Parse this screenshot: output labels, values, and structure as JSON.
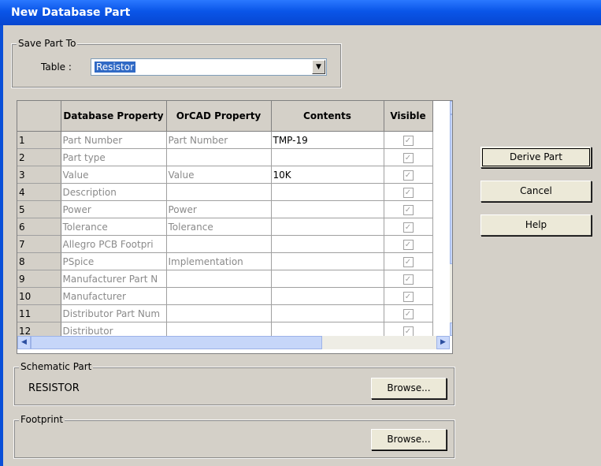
{
  "window": {
    "title": "New Database Part"
  },
  "save_part": {
    "legend": "Save Part To",
    "table_label": "Table :",
    "table_value": "Resistor"
  },
  "grid": {
    "columns": [
      "Database Property",
      "OrCAD Property",
      "Contents",
      "Visible"
    ],
    "rows": [
      {
        "num": "1",
        "db": "Part Number",
        "orcad": "Part Number",
        "contents": "TMP-19",
        "visible": true
      },
      {
        "num": "2",
        "db": "Part type",
        "orcad": "",
        "contents": "",
        "visible": true
      },
      {
        "num": "3",
        "db": "Value",
        "orcad": "Value",
        "contents": "10K",
        "visible": true
      },
      {
        "num": "4",
        "db": "Description",
        "orcad": "",
        "contents": "",
        "visible": true
      },
      {
        "num": "5",
        "db": "Power",
        "orcad": "Power",
        "contents": "",
        "visible": true
      },
      {
        "num": "6",
        "db": "Tolerance",
        "orcad": "Tolerance",
        "contents": "",
        "visible": true
      },
      {
        "num": "7",
        "db": "Allegro PCB Footpri",
        "orcad": "",
        "contents": "",
        "visible": true
      },
      {
        "num": "8",
        "db": "PSpice",
        "orcad": "Implementation",
        "contents": "",
        "visible": true
      },
      {
        "num": "9",
        "db": "Manufacturer Part N",
        "orcad": "",
        "contents": "",
        "visible": true
      },
      {
        "num": "10",
        "db": "Manufacturer",
        "orcad": "",
        "contents": "",
        "visible": true
      },
      {
        "num": "11",
        "db": "Distributor Part Num",
        "orcad": "",
        "contents": "",
        "visible": true
      },
      {
        "num": "12",
        "db": "Distributor",
        "orcad": "",
        "contents": "",
        "visible": true
      }
    ]
  },
  "buttons": {
    "derive": "Derive Part",
    "cancel": "Cancel",
    "help": "Help"
  },
  "schematic": {
    "legend": "Schematic Part",
    "value": "RESISTOR",
    "browse": "Browse..."
  },
  "footprint": {
    "legend": "Footprint",
    "browse": "Browse..."
  },
  "icons": {
    "dropdown": "chevron-down-icon",
    "scroll_up": "arrow-up-icon",
    "scroll_down": "arrow-down-icon",
    "scroll_left": "arrow-left-icon",
    "scroll_right": "arrow-right-icon",
    "checkbox": "checkmark-icon"
  }
}
